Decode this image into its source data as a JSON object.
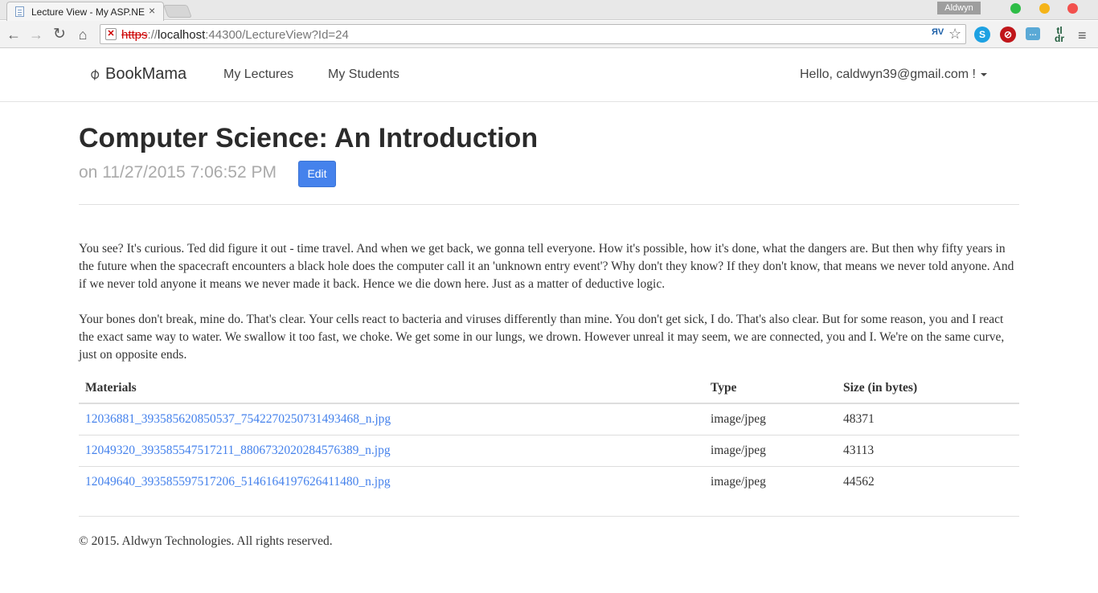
{
  "browser": {
    "tab_title": "Lecture View - My ASP.NE",
    "tab_close": "×",
    "profile_name": "Aldwyn",
    "url_scheme": "https",
    "url_rest": "://",
    "url_host": "localhost",
    "url_path": ":44300/LectureView?Id=24",
    "icons": {
      "back": "←",
      "forward": "→",
      "reload": "↻",
      "home": "⌂",
      "star": "☆",
      "menu": "≡",
      "insecure": "✕",
      "ext_skype": "S",
      "ext_block": "⊘",
      "ext_chat": "…",
      "ext_tldr": "tl dr",
      "ext_omni": "ЯV"
    }
  },
  "navbar": {
    "brand": "BookMama",
    "brand_icon": "📎",
    "links": [
      "My Lectures",
      "My Students"
    ],
    "user_greeting": "Hello, caldwyn39@gmail.com !"
  },
  "lecture": {
    "title": "Computer Science: An Introduction",
    "date_line": "on 11/27/2015 7:06:52 PM",
    "edit_label": "Edit",
    "paragraphs": [
      "You see? It's curious. Ted did figure it out - time travel. And when we get back, we gonna tell everyone. How it's possible, how it's done, what the dangers are. But then why fifty years in the future when the spacecraft encounters a black hole does the computer call it an 'unknown entry event'? Why don't they know? If they don't know, that means we never told anyone. And if we never told anyone it means we never made it back. Hence we die down here. Just as a matter of deductive logic.",
      "Your bones don't break, mine do. That's clear. Your cells react to bacteria and viruses differently than mine. You don't get sick, I do. That's also clear. But for some reason, you and I react the exact same way to water. We swallow it too fast, we choke. We get some in our lungs, we drown. However unreal it may seem, we are connected, you and I. We're on the same curve, just on opposite ends."
    ]
  },
  "materials": {
    "headers": [
      "Materials",
      "Type",
      "Size (in bytes)"
    ],
    "rows": [
      {
        "name": "12036881_393585620850537_7542270250731493468_n.jpg",
        "type": "image/jpeg",
        "size": "48371"
      },
      {
        "name": "12049320_393585547517211_8806732020284576389_n.jpg",
        "type": "image/jpeg",
        "size": "43113"
      },
      {
        "name": "12049640_393585597517206_5146164197626411480_n.jpg",
        "type": "image/jpeg",
        "size": "44562"
      }
    ]
  },
  "footer": {
    "text": "© 2015. Aldwyn Technologies. All rights reserved."
  }
}
